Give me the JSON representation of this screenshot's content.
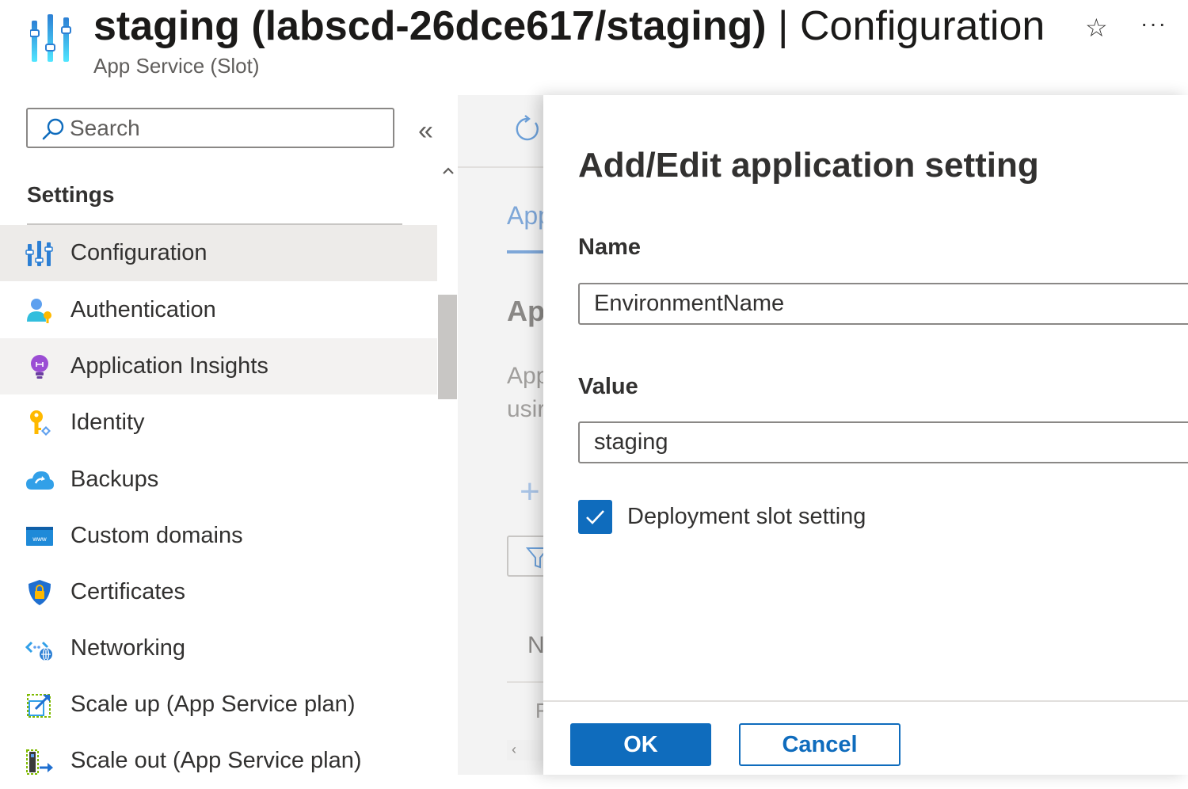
{
  "header": {
    "app_icon": "configuration-icon",
    "title_main": "staging (labscd-26dce617/staging)",
    "title_separator": " | ",
    "title_page": "Configuration",
    "subtitle": "App Service (Slot)",
    "favorite_icon": "star-icon",
    "more_icon": "more-icon",
    "star_glyph": "☆",
    "more_glyph": "···"
  },
  "search": {
    "placeholder": "Search",
    "icon": "search-icon",
    "collapse_glyph": "«"
  },
  "sidebar": {
    "section_heading": "Settings",
    "items": [
      {
        "label": "Configuration",
        "icon": "configuration-icon",
        "state": "selected"
      },
      {
        "label": "Authentication",
        "icon": "authentication-icon",
        "state": "normal"
      },
      {
        "label": "Application Insights",
        "icon": "lightbulb-icon",
        "state": "hover"
      },
      {
        "label": "Identity",
        "icon": "key-icon",
        "state": "normal"
      },
      {
        "label": "Backups",
        "icon": "cloud-backup-icon",
        "state": "normal"
      },
      {
        "label": "Custom domains",
        "icon": "www-icon",
        "state": "normal"
      },
      {
        "label": "Certificates",
        "icon": "shield-lock-icon",
        "state": "normal"
      },
      {
        "label": "Networking",
        "icon": "network-icon",
        "state": "normal"
      },
      {
        "label": "Scale up (App Service plan)",
        "icon": "scale-up-icon",
        "state": "normal"
      },
      {
        "label": "Scale out (App Service plan)",
        "icon": "scale-out-icon",
        "state": "normal"
      }
    ]
  },
  "middle": {
    "tab": "App",
    "heading": "Ap",
    "desc_line1": "App",
    "desc_line2": "usir",
    "plus_glyph": "+",
    "column": "N",
    "row_text": "F",
    "scroll_left_glyph": "‹"
  },
  "dialog": {
    "title": "Add/Edit application setting",
    "name_label": "Name",
    "name_value": "EnvironmentName",
    "value_label": "Value",
    "value_value": "staging",
    "slot_setting_label": "Deployment slot setting",
    "slot_setting_checked": true,
    "ok_label": "OK",
    "cancel_label": "Cancel"
  },
  "colors": {
    "accent": "#0f6cbd",
    "selected_bg": "#edebe9",
    "hover_bg": "#f3f2f1"
  }
}
